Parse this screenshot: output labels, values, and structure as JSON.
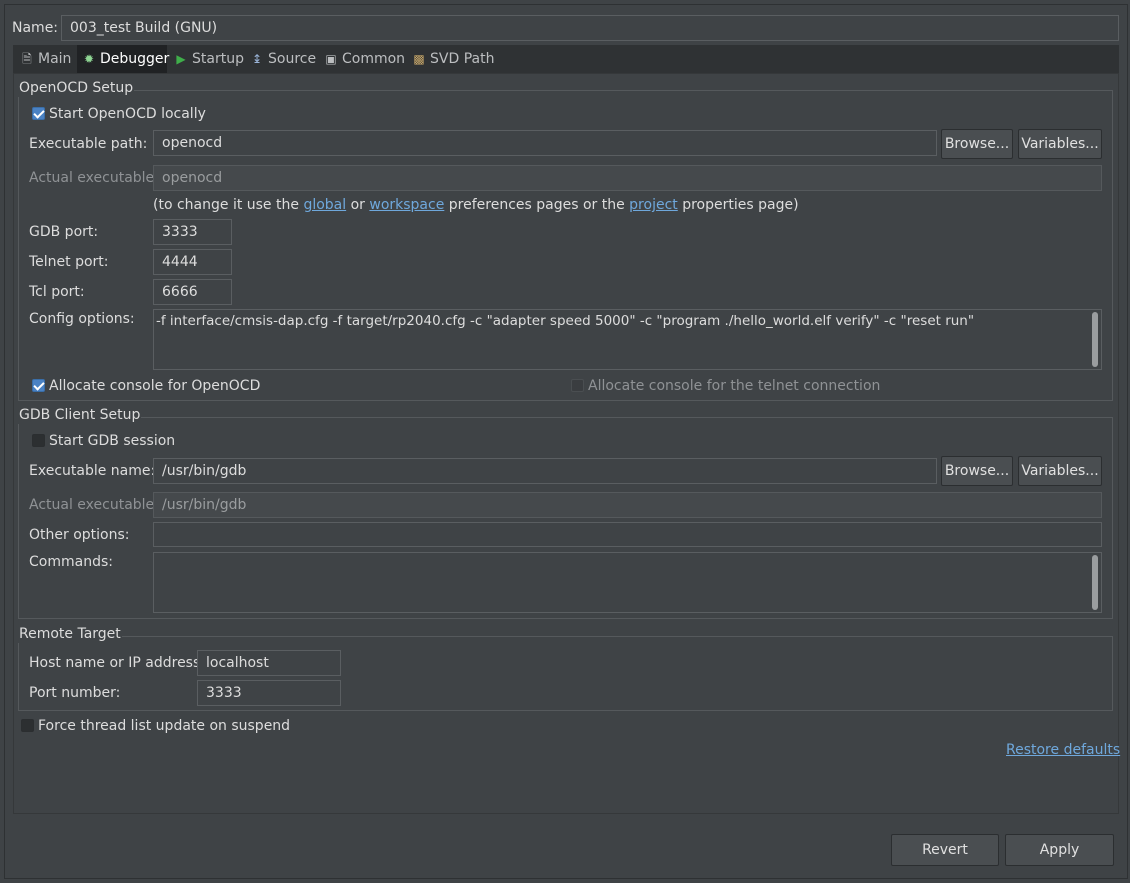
{
  "name": {
    "label": "Name:",
    "value": "003_test Build (GNU)"
  },
  "tabs": [
    {
      "label": "Main",
      "icon": "page-icon"
    },
    {
      "label": "Debugger",
      "icon": "bug-icon"
    },
    {
      "label": "Startup",
      "icon": "play-icon"
    },
    {
      "label": "Source",
      "icon": "source-icon"
    },
    {
      "label": "Common",
      "icon": "window-icon"
    },
    {
      "label": "SVD Path",
      "icon": "tree-icon"
    }
  ],
  "openocd": {
    "title": "OpenOCD Setup",
    "start_locally": {
      "label": "Start OpenOCD locally",
      "checked": true
    },
    "exe_label": "Executable path:",
    "exe_value": "openocd",
    "browse": "Browse...",
    "variables": "Variables...",
    "actual_label": "Actual executable:",
    "actual_value": "openocd",
    "hint_pre": "(to change it use the ",
    "hint_global": "global",
    "hint_or": " or ",
    "hint_workspace": "workspace",
    "hint_mid": " preferences pages or the ",
    "hint_project": "project",
    "hint_post": " properties page)",
    "gdb_port_label": "GDB port:",
    "gdb_port": "3333",
    "telnet_port_label": "Telnet port:",
    "telnet_port": "4444",
    "tcl_port_label": "Tcl port:",
    "tcl_port": "6666",
    "config_label": "Config options:",
    "config_value": "-f interface/cmsis-dap.cfg -f target/rp2040.cfg  -c \"adapter speed 5000\" -c \"program ./hello_world.elf verify\" -c \"reset run\"",
    "alloc_console": {
      "label": "Allocate console for OpenOCD",
      "checked": true
    },
    "alloc_telnet": {
      "label": "Allocate console for the telnet connection",
      "checked": false
    }
  },
  "gdb": {
    "title": "GDB Client Setup",
    "start_session": {
      "label": "Start GDB session",
      "checked": false
    },
    "exe_label": "Executable name:",
    "exe_value": "/usr/bin/gdb",
    "browse": "Browse...",
    "variables": "Variables...",
    "actual_label": "Actual executable:",
    "actual_value": "/usr/bin/gdb",
    "other_label": "Other options:",
    "other_value": "",
    "commands_label": "Commands:",
    "commands_value": ""
  },
  "remote": {
    "title": "Remote Target",
    "host_label": "Host name or IP address:",
    "host_value": "localhost",
    "port_label": "Port number:",
    "port_value": "3333"
  },
  "force_thread": {
    "label": "Force thread list update on suspend",
    "checked": false
  },
  "restore_defaults": "Restore defaults",
  "footer": {
    "revert": "Revert",
    "apply": "Apply"
  }
}
